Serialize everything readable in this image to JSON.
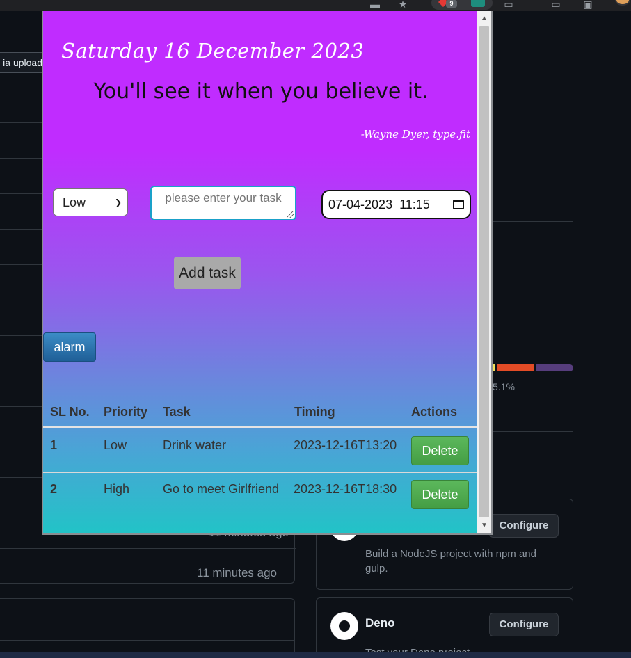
{
  "browser": {
    "extension_badge": "9"
  },
  "background_page": {
    "tooltip": "ia upload",
    "times": [
      "11 minutes ago",
      "11 minutes ago"
    ],
    "language_percent": "5.1%",
    "colors": [
      "#3178c6",
      "#e34c26",
      "#563d7c"
    ],
    "cards": [
      {
        "title": "",
        "description": "Build a NodeJS project with npm and gulp.",
        "button": "Configure"
      },
      {
        "title": "Deno",
        "description": "Test your Deno project",
        "button": "Configure"
      }
    ]
  },
  "popup": {
    "date": "Saturday 16 December 2023",
    "quote": "You'll see it when you believe it.",
    "author": "-Wayne Dyer, type.fit",
    "form": {
      "priority_value": "Low",
      "task_placeholder": "please enter your task",
      "datetime_value": "07-04-2023  11:15",
      "add_label": "Add task"
    },
    "alarm_label": "alarm",
    "table": {
      "headers": [
        "SL No.",
        "Priority",
        "Task",
        "Timing",
        "Actions"
      ],
      "rows": [
        {
          "sl": "1",
          "priority": "Low",
          "task": "Drink water",
          "timing": "2023-12-16T13:20",
          "action": "Delete"
        },
        {
          "sl": "2",
          "priority": "High",
          "task": "Go to meet Girlfriend",
          "timing": "2023-12-16T18:30",
          "action": "Delete"
        }
      ]
    }
  }
}
